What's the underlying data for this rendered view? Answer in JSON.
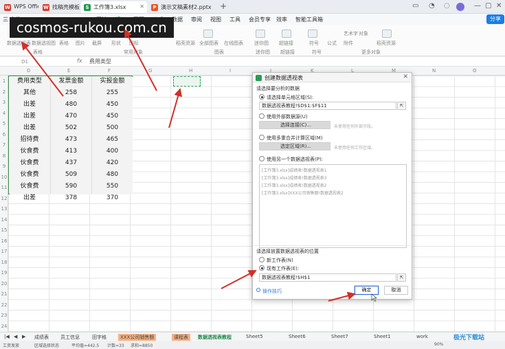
{
  "watermark": "cosmos-rukou.com.cn",
  "titlebar": {
    "tabs": [
      {
        "label": "WPS Office",
        "color": "#d83b2b",
        "icon": "W"
      },
      {
        "label": "找稿壳模板",
        "color": "#d83b2b",
        "icon": "W"
      },
      {
        "label": "工作簿3.xlsx",
        "color": "#1d9a52",
        "icon": "S",
        "active": true
      },
      {
        "label": "演示文稿素材2.pptx",
        "color": "#e0592a",
        "icon": "P"
      }
    ],
    "new_tab": "+"
  },
  "menu": {
    "items": [
      "三 文件",
      "开始",
      "插入",
      "页面",
      "公式",
      "数据",
      "审阅",
      "视图",
      "工具",
      "会员专享",
      "效率",
      "智能工具箱"
    ],
    "active_index": 2,
    "share": "分享"
  },
  "ribbon": {
    "buttons": [
      "数据透视表",
      "数据透视图",
      "表格",
      "图片",
      "截屏",
      "形状",
      "图标",
      "稻壳资源",
      "全部图表",
      "在线图表",
      "迷你图",
      "超链接",
      "符号",
      "公式",
      "艺术字",
      "对象",
      "附件",
      "稻壳资源"
    ],
    "groups": [
      "表格",
      "常用对象",
      "图表",
      "迷你图",
      "超链接",
      "符号",
      "更多对象"
    ]
  },
  "formula_bar": {
    "name_box": "D1",
    "fx": "fx",
    "value": "费用类型"
  },
  "columns": [
    "D",
    "E",
    "F",
    "G",
    "H",
    "I",
    "J",
    "K",
    "L",
    "M",
    "N",
    "O"
  ],
  "rows": [
    "1",
    "2",
    "3",
    "4",
    "5",
    "6",
    "7",
    "8",
    "9",
    "10",
    "11",
    "12",
    "13",
    "14",
    "15",
    "16",
    "17",
    "18",
    "19",
    "20",
    "21",
    "22",
    "23",
    "24"
  ],
  "table": {
    "headers": [
      "费用类型",
      "发票金额",
      "实报金额"
    ],
    "rows": [
      [
        "其他",
        "258",
        "255"
      ],
      [
        "出差",
        "480",
        "450"
      ],
      [
        "出差",
        "470",
        "450"
      ],
      [
        "出差",
        "502",
        "500"
      ],
      [
        "招待费",
        "473",
        "465"
      ],
      [
        "伙食费",
        "413",
        "400"
      ],
      [
        "伙食费",
        "437",
        "420"
      ],
      [
        "伙食费",
        "509",
        "480"
      ],
      [
        "伙食费",
        "590",
        "550"
      ],
      [
        "出差",
        "378",
        "370"
      ]
    ]
  },
  "dialog": {
    "title": "创建数据透视表",
    "section1": "请选择要分析的数据",
    "opt_range": "请选择单元格区域(S):",
    "range_value": "数据透视表教程!$D$1:$F$11",
    "opt_external": "使用外部数据源(U)",
    "btn_select_conn": "选择连接(C)...",
    "hint_external": "未使用任何外部字段。",
    "opt_multi": "使用多重合并计算区域(M)",
    "btn_select_region": "选定区域(R)...",
    "hint_multi": "未使用任何工作区域。",
    "opt_other_pivot": "使用另一个数据透视表(P):",
    "pivot_list": [
      "[工作簿3.xlsx]成绩表!数据透视表1",
      "[工作簿3.xlsx]成绩表!数据透视表3",
      "[工作簿3.xlsx]成绩表!数据透视表2",
      "[工作簿3.xlsx]XXX公司销售额!数据透视表2"
    ],
    "section2": "请选择放置数据透视表的位置",
    "opt_new_sheet": "新工作表(N)",
    "opt_existing_sheet": "现有工作表(E):",
    "location_value": "数据透视表教程!$H$1",
    "tips": "操作技巧",
    "ok": "确定",
    "cancel": "取消"
  },
  "sheets": {
    "tabs": [
      "成绩表",
      "员工信息",
      "田字格",
      "XXX公司销售额",
      "课程表",
      "数据透视表教程",
      "Sheet5",
      "Sheet6",
      "Sheet7",
      "Sheet1",
      "work"
    ],
    "active": "数据透视表教程",
    "orange": [
      "XXX公司销售额",
      "课程表"
    ]
  },
  "status": {
    "mode": "工资发放",
    "selection_status": "区域选择状态",
    "average": "平均值=442.5",
    "count": "计数=33",
    "sum": "求和=8850",
    "zoom": "90%"
  },
  "logo": "极光下载站",
  "colors": {
    "accent_green": "#1c8a4a",
    "arrow_red": "#d0302a",
    "table_border": "#3d8a4a"
  }
}
